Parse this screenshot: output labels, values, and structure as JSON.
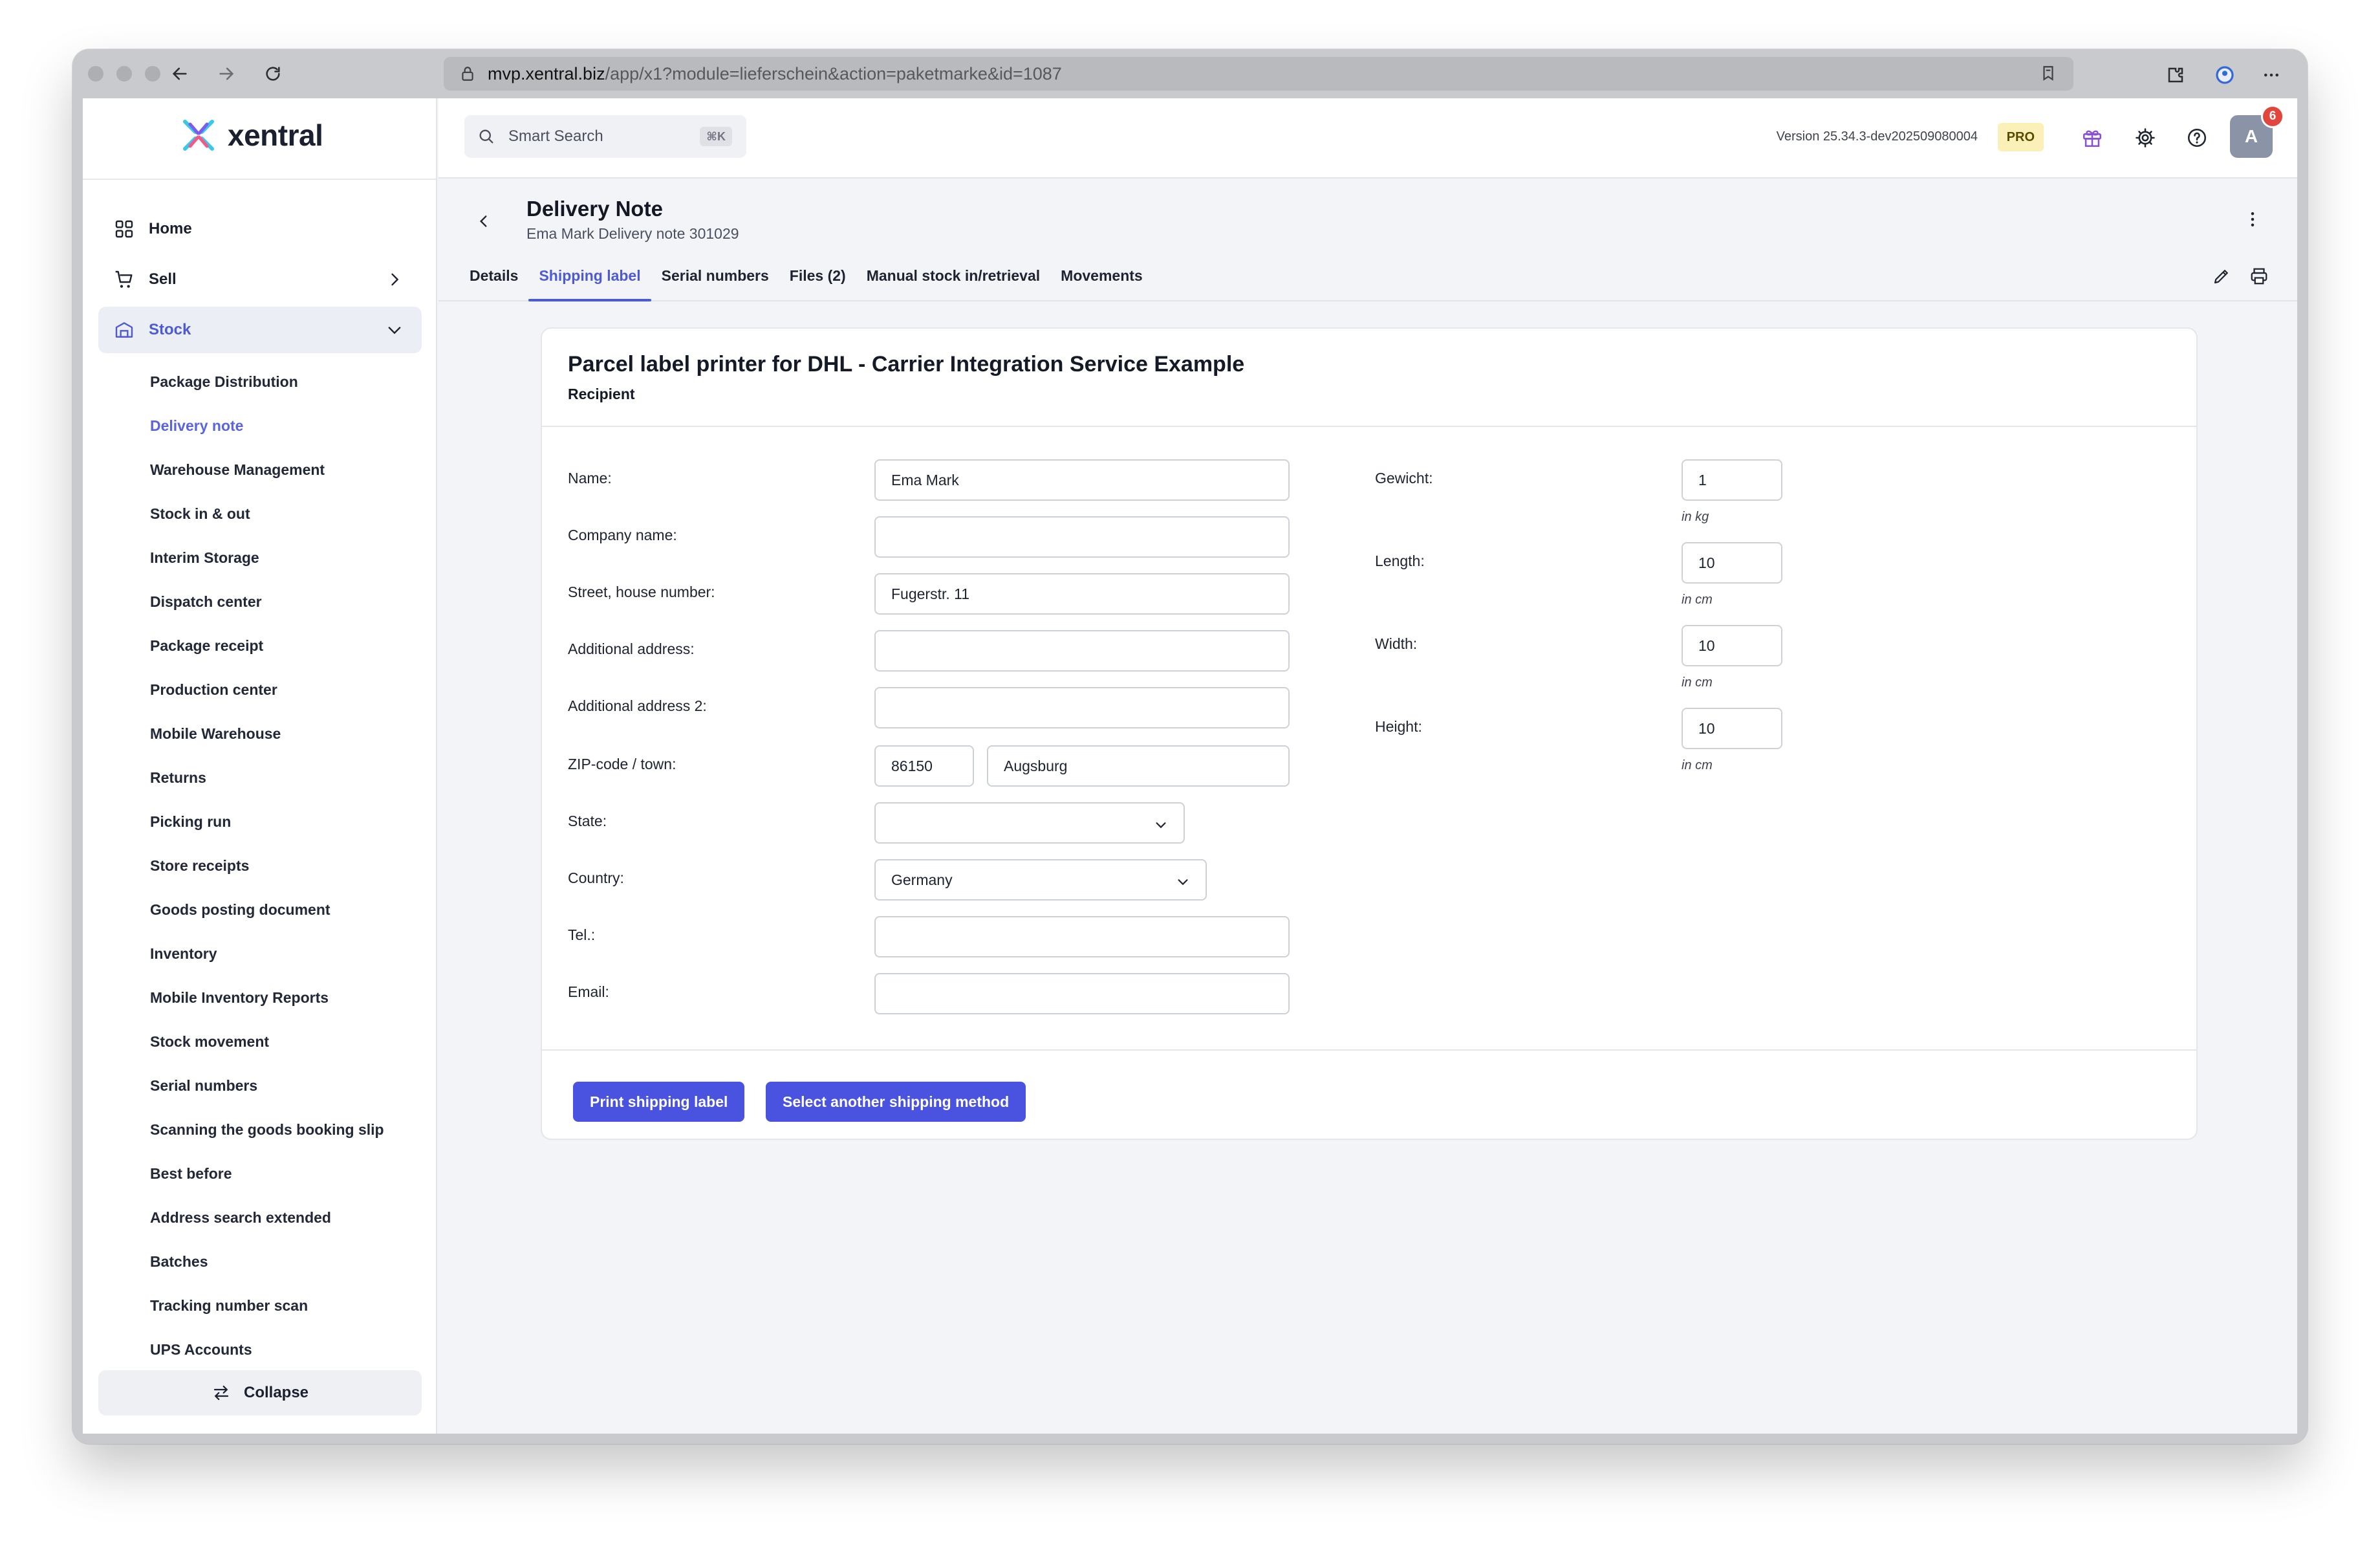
{
  "browser": {
    "url_host": "mvp.xentral.biz",
    "url_path": "/app/x1?module=lieferschein&action=paketmarke&id=1087"
  },
  "logo": {
    "text": "xentral"
  },
  "search": {
    "placeholder": "Smart Search",
    "shortcut": "⌘K"
  },
  "topbar": {
    "version": "Version 25.34.3-dev202509080004",
    "pro_badge": "PRO",
    "avatar_initial": "A",
    "notification_count": "6"
  },
  "sidebar": {
    "main": [
      {
        "label": "Home",
        "icon": "grid-icon"
      },
      {
        "label": "Sell",
        "icon": "cart-icon"
      },
      {
        "label": "Stock",
        "icon": "warehouse-icon"
      }
    ],
    "stock_items": [
      "Package Distribution",
      "Delivery note",
      "Warehouse Management",
      "Stock in & out",
      "Interim Storage",
      "Dispatch center",
      "Package receipt",
      "Production center",
      "Mobile Warehouse",
      "Returns",
      "Picking run",
      "Store receipts",
      "Goods posting document",
      "Inventory",
      "Mobile Inventory Reports",
      "Stock movement",
      "Serial numbers",
      "Scanning the goods booking slip",
      "Best before",
      "Address search extended",
      "Batches",
      "Tracking number scan",
      "UPS Accounts"
    ],
    "active_item": "Delivery note",
    "collapse_label": "Collapse"
  },
  "page": {
    "title": "Delivery Note",
    "subtitle": "Ema Mark Delivery note 301029",
    "tabs": [
      "Details",
      "Shipping label",
      "Serial numbers",
      "Files (2)",
      "Manual stock in/retrieval",
      "Movements"
    ],
    "active_tab": "Shipping label"
  },
  "card": {
    "title": "Parcel label printer for DHL - Carrier Integration Service Example",
    "subtitle": "Recipient",
    "fields": {
      "name": {
        "label": "Name:",
        "value": "Ema Mark"
      },
      "company": {
        "label": "Company name:",
        "value": ""
      },
      "street": {
        "label": "Street, house number:",
        "value": "Fugerstr. 11"
      },
      "address2": {
        "label": "Additional address:",
        "value": ""
      },
      "address3": {
        "label": "Additional address 2:",
        "value": ""
      },
      "zip_town": {
        "label": "ZIP-code / town:",
        "zip": "86150",
        "town": "Augsburg"
      },
      "state": {
        "label": "State:",
        "value": ""
      },
      "country": {
        "label": "Country:",
        "value": "Germany"
      },
      "tel": {
        "label": "Tel.:",
        "value": ""
      },
      "email": {
        "label": "Email:",
        "value": ""
      }
    },
    "package": {
      "weight": {
        "label": "Gewicht:",
        "value": "1",
        "unit": "in kg"
      },
      "length": {
        "label": "Length:",
        "value": "10",
        "unit": "in cm"
      },
      "width": {
        "label": "Width:",
        "value": "10",
        "unit": "in cm"
      },
      "height": {
        "label": "Height:",
        "value": "10",
        "unit": "in cm"
      }
    },
    "buttons": {
      "print": "Print shipping label",
      "select_method": "Select another shipping method"
    }
  },
  "colors": {
    "accent": "#4d5ad6",
    "button": "#4a52e0",
    "notification": "#e2453c",
    "pro_badge": "#fbf0b8"
  }
}
